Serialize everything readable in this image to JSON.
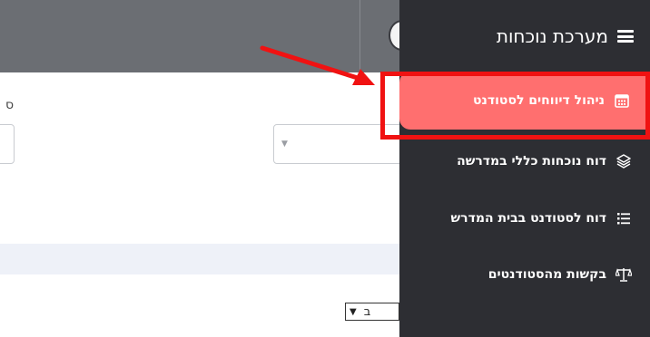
{
  "sidebar": {
    "title": "מערכת נוכחות",
    "items": [
      {
        "label": "ניהול דיווחים לסטודנט",
        "icon": "calendar-icon",
        "active": true
      },
      {
        "label": "דוח נוכחות כללי במדרשה",
        "icon": "layers-icon"
      },
      {
        "label": "דוח לסטודנט בבית המדרש",
        "icon": "list-icon"
      },
      {
        "label": "בקשות מהסטודנטים",
        "icon": "balance-scale-icon"
      }
    ]
  },
  "main": {
    "field_label_fragment": "ס",
    "page_size_fragment": "ב"
  },
  "colors": {
    "sidebar_bg": "#2d2e33",
    "active_item": "#ff6f6f",
    "annotation": "#f01212",
    "topbar": "#6b6e73"
  }
}
